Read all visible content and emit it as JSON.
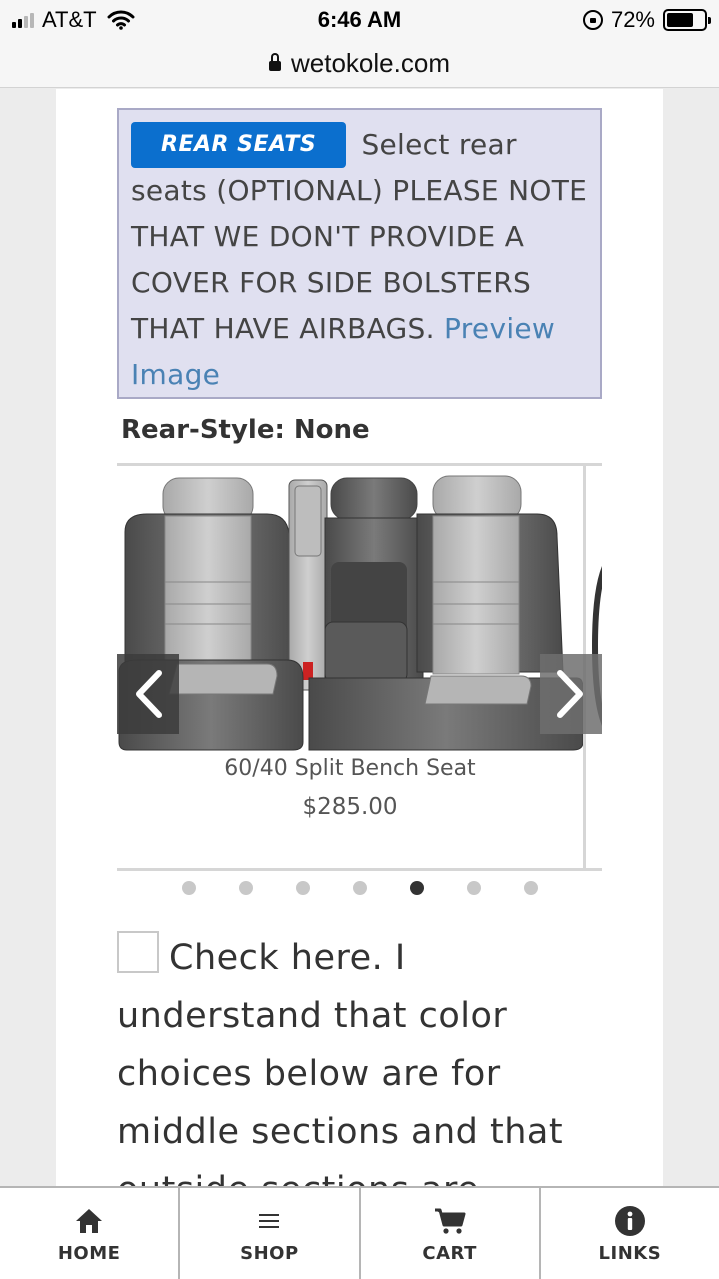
{
  "status_bar": {
    "carrier": "AT&T",
    "time": "6:46 AM",
    "battery": "72%",
    "battery_level": 0.72,
    "signal_bars": 2,
    "icons": [
      "signal-icon",
      "wifi-icon",
      "rotation-lock-icon",
      "battery-icon"
    ]
  },
  "browser": {
    "url": "wetokole.com",
    "icon": "padlock-icon"
  },
  "notice": {
    "button_label": "REAR SEATS",
    "text": "Select rear seats (OPTIONAL) PLEASE NOTE THAT WE DON'T PROVIDE A COVER FOR SIDE BOLSTERS THAT HAVE AIRBAGS.",
    "link": "Preview Image",
    "button_color": "#0b6fce",
    "background": "#e0e0f0"
  },
  "rear_style": {
    "label": "Rear-Style:",
    "value": "None"
  },
  "carousel": {
    "caption": "60/40 Split Bench Seat",
    "price": "$285.00",
    "active_index": 4,
    "slide_count": 7,
    "prev_icon": "chevron-left-icon",
    "next_icon": "chevron-right-icon"
  },
  "acknowledgement": {
    "checked": false,
    "text": "Check here. I understand that color choices below are for middle sections and that outside sections are"
  },
  "bottom_nav": [
    {
      "label": "HOME",
      "icon": "home-icon"
    },
    {
      "label": "SHOP",
      "icon": "menu-icon"
    },
    {
      "label": "CART",
      "icon": "cart-icon"
    },
    {
      "label": "LINKS",
      "icon": "info-icon"
    }
  ]
}
